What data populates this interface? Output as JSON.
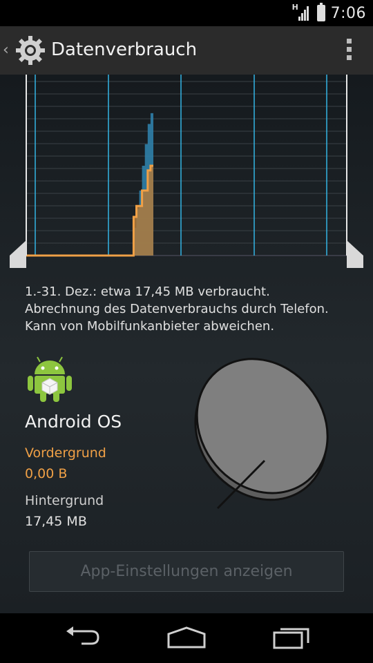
{
  "status_bar": {
    "network": "H",
    "time": "7:06"
  },
  "action_bar": {
    "title": "Datenverbrauch",
    "icon": "gear-icon",
    "overflow_icon": "overflow-menu-icon"
  },
  "usage": {
    "summary_lines": [
      "1.-31. Dez.: etwa 17,45 MB verbraucht.",
      "Abrechnung des Datenverbrauchs durch Telefon.",
      "Kann von Mobilfunkanbieter abweichen."
    ]
  },
  "app": {
    "icon": "android-robot-icon",
    "name": "Android OS",
    "foreground_label": "Vordergrund",
    "foreground_value": "0,00 B",
    "background_label": "Hintergrund",
    "background_value": "17,45 MB",
    "settings_button": "App-Einstellungen anzeigen"
  },
  "colors": {
    "foreground": "#f0a046",
    "background_series": "#2f7fa8",
    "accent": "#33b5e5"
  },
  "chart_data": {
    "type": "area",
    "title": "",
    "xlabel": "",
    "ylabel": "",
    "series": [
      {
        "values": [
          0,
          0,
          0,
          0,
          0,
          0,
          0,
          0,
          0,
          0,
          0,
          0,
          0,
          0,
          0,
          0,
          0,
          0,
          0,
          0,
          0,
          0,
          0,
          0,
          0,
          0,
          0,
          0,
          0,
          0,
          0,
          0,
          0,
          0,
          0,
          0,
          0,
          0,
          0.18,
          0.3,
          0.42,
          0.58,
          0.72,
          0.85,
          0.92,
          1.0
        ]
      },
      {
        "values": [
          0,
          0,
          0,
          0,
          0,
          0,
          0,
          0,
          0,
          0,
          0,
          0,
          0,
          0,
          0,
          0,
          0,
          0,
          0,
          0,
          0,
          0,
          0,
          0,
          0,
          0,
          0,
          0,
          0,
          0,
          0,
          0,
          0,
          0,
          0,
          0,
          0,
          0,
          0.25,
          0.32,
          0.32,
          0.42,
          0.42,
          0.55,
          0.58,
          0.58
        ]
      }
    ],
    "ylim": [
      0,
      1.08
    ]
  },
  "nav": {
    "back_icon": "back-icon",
    "home_icon": "home-icon",
    "recents_icon": "recents-icon"
  }
}
